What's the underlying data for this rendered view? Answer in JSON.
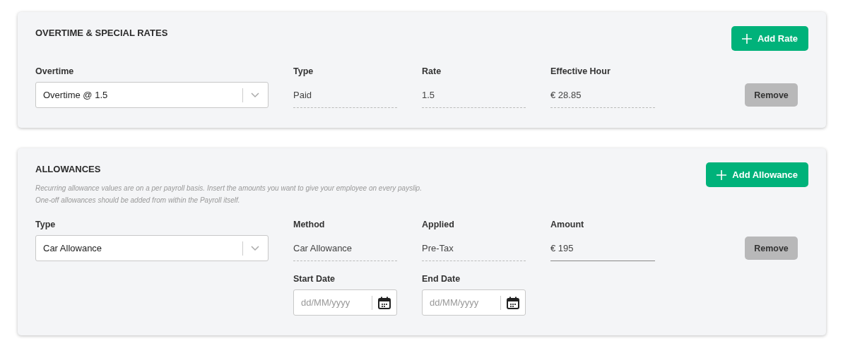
{
  "sections": [
    {
      "title": "OVERTIME & SPECIAL RATES",
      "add_button": "Add Rate",
      "rows": [
        {
          "fields": [
            {
              "label": "Overtime",
              "kind": "select",
              "value": "Overtime @ 1.5"
            },
            {
              "label": "Type",
              "kind": "static",
              "value": "Paid"
            },
            {
              "label": "Rate",
              "kind": "static",
              "value": "1.5"
            },
            {
              "label": "Effective Hour",
              "kind": "static",
              "value": "€ 28.85"
            }
          ],
          "remove_button": "Remove"
        }
      ]
    },
    {
      "title": "ALLOWANCES",
      "add_button": "Add Allowance",
      "description": [
        "Recurring allowance values are on a per payroll basis. Insert the amounts you want to give your employee on every payslip.",
        "One-off allowances should be added from within the Payroll itself."
      ],
      "rows": [
        {
          "fields": [
            {
              "label": "Type",
              "kind": "select",
              "value": "Car Allowance"
            },
            {
              "label": "Method",
              "kind": "static",
              "value": "Car Allowance"
            },
            {
              "label": "Applied",
              "kind": "static",
              "value": "Pre-Tax"
            },
            {
              "label": "Amount",
              "kind": "input",
              "value": "€ 195"
            }
          ],
          "remove_button": "Remove"
        },
        {
          "fields": [
            {
              "label": "Start Date",
              "kind": "date",
              "placeholder": "dd/MM/yyyy"
            },
            {
              "label": "End Date",
              "kind": "date",
              "placeholder": "dd/MM/yyyy"
            }
          ]
        }
      ]
    }
  ]
}
